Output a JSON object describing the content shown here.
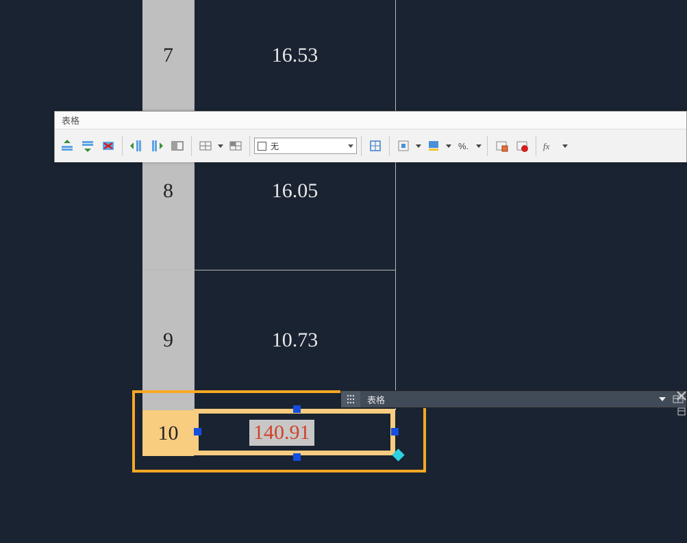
{
  "ribbon": {
    "title": "表格",
    "fill_combo": "无",
    "icons": {
      "insert_above": "insert-row-above-icon",
      "insert_below": "insert-row-below-icon",
      "delete_row": "delete-row-icon",
      "insert_col_left": "insert-col-left-icon",
      "insert_col_right": "insert-col-right-icon",
      "merge": "merge-cells-icon",
      "unmerge": "unmerge-cells-icon",
      "cell_style": "cell-style-icon",
      "borders": "borders-icon",
      "align": "align-icon",
      "fill": "fill-color-icon",
      "percent": "percent-icon",
      "lock": "lock-cell-icon",
      "data": "data-link-icon",
      "fx": "formula-icon"
    }
  },
  "rows": [
    {
      "hdr": "7",
      "val": "16.53"
    },
    {
      "hdr": "8",
      "val": "16.05"
    },
    {
      "hdr": "9",
      "val": "10.73"
    },
    {
      "hdr": "10",
      "val": "140.91"
    }
  ],
  "qp": {
    "label": "表格"
  }
}
